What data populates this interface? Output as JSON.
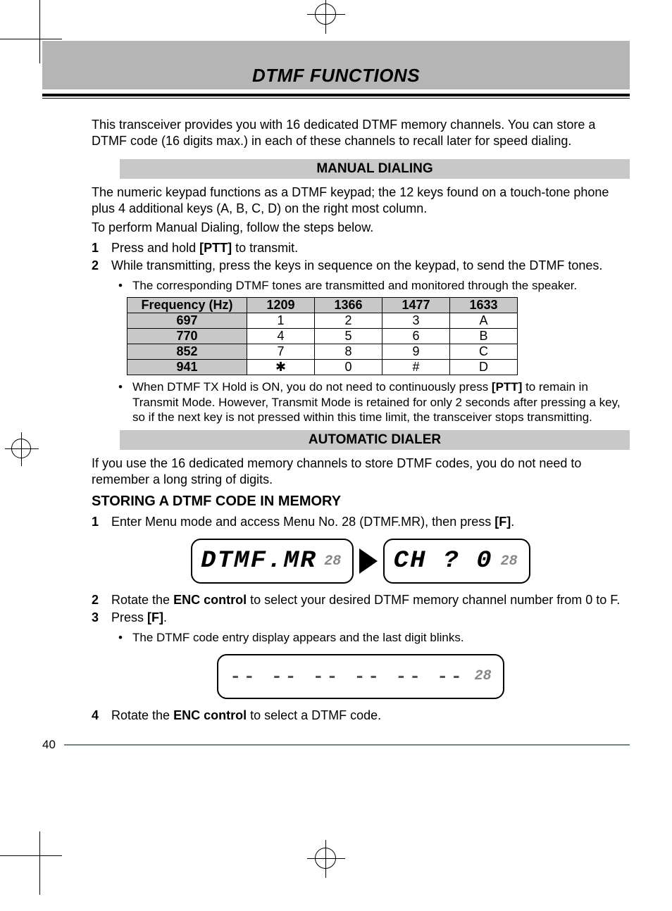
{
  "page_title": "DTMF FUNCTIONS",
  "intro": "This transceiver provides you with 16 dedicated DTMF memory channels.  You can store a DTMF code (16 digits max.) in each of these channels to recall later for speed dialing.",
  "manual": {
    "heading": "MANUAL DIALING",
    "para1": "The numeric keypad functions as a DTMF keypad; the 12 keys found on a touch-tone phone plus 4 additional keys (A, B, C, D) on the right most column.",
    "para2": "To perform Manual Dialing, follow the steps below.",
    "steps": [
      {
        "num": "1",
        "pre": "Press and hold ",
        "bold": "[PTT]",
        "post": " to transmit."
      },
      {
        "num": "2",
        "pre": "While transmitting, press the keys in sequence on the keypad, to send the DTMF tones.",
        "bold": "",
        "post": ""
      }
    ],
    "bullet1": "The corresponding DTMF tones are transmitted and monitored through the speaker.",
    "table": {
      "header": [
        "Frequency (Hz)",
        "1209",
        "1366",
        "1477",
        "1633"
      ],
      "rows": [
        [
          "697",
          "1",
          "2",
          "3",
          "A"
        ],
        [
          "770",
          "4",
          "5",
          "6",
          "B"
        ],
        [
          "852",
          "7",
          "8",
          "9",
          "C"
        ],
        [
          "941",
          "✱",
          "0",
          "#",
          "D"
        ]
      ]
    },
    "bullet2_pre": "When DTMF TX Hold is ON, you do not need to continuously press ",
    "bullet2_bold": "[PTT]",
    "bullet2_post": " to remain in Transmit Mode.  However, Transmit Mode is retained for only 2 seconds after pressing a key, so if the next key is not pressed within this time limit, the transceiver stops transmitting."
  },
  "auto": {
    "heading": "AUTOMATIC DIALER",
    "para": "If you use the 16 dedicated memory channels to store DTMF codes, you do not need to remember a long string of digits.",
    "sub": "STORING A DTMF CODE IN MEMORY",
    "steps": {
      "s1": {
        "num": "1",
        "pre": "Enter Menu mode and access Menu No. 28 (DTMF.MR), then press ",
        "bold": "[F]",
        "post": "."
      },
      "s2": {
        "num": "2",
        "pre": "Rotate the ",
        "bold": "ENC control",
        "post": " to select your desired DTMF memory channel number from 0 to F."
      },
      "s3": {
        "num": "3",
        "pre": "Press ",
        "bold": "[F]",
        "post": "."
      },
      "s3_bullet": "The DTMF code entry display appears and the last digit blinks.",
      "s4": {
        "num": "4",
        "pre": "Rotate the ",
        "bold": "ENC control",
        "post": " to select a DTMF code."
      }
    },
    "lcd1": {
      "big": "DTMF.MR",
      "small": "28"
    },
    "lcd2": {
      "big": "CH  ?   0",
      "small": "28"
    },
    "lcd3": {
      "dashes": "-- -- -- -- -- --",
      "small": "28"
    }
  },
  "chart_data": {
    "type": "table",
    "title": "DTMF Frequency (Hz)",
    "columns": [
      "Frequency (Hz)",
      "1209",
      "1366",
      "1477",
      "1633"
    ],
    "rows": [
      {
        "row_freq": 697,
        "1209": "1",
        "1366": "2",
        "1477": "3",
        "1633": "A"
      },
      {
        "row_freq": 770,
        "1209": "4",
        "1366": "5",
        "1477": "6",
        "1633": "B"
      },
      {
        "row_freq": 852,
        "1209": "7",
        "1366": "8",
        "1477": "9",
        "1633": "C"
      },
      {
        "row_freq": 941,
        "1209": "*",
        "1366": "0",
        "1477": "#",
        "1633": "D"
      }
    ]
  },
  "page_number": "40"
}
